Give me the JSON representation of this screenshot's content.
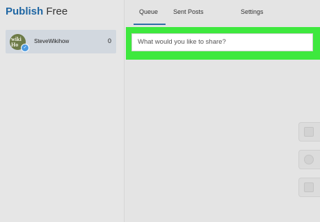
{
  "brand": {
    "strong": "Publish",
    "light": "Free"
  },
  "accounts": [
    {
      "avatar_text": "wiki\nHo",
      "name": "SteveWikihow",
      "count": "0",
      "badge_icon": "twitter-icon"
    }
  ],
  "tabs": [
    {
      "label": "Queue",
      "active": true
    },
    {
      "label": "Sent Posts",
      "active": false
    },
    {
      "label": "Settings",
      "active": false
    }
  ],
  "composer": {
    "placeholder": "What would you like to share?"
  },
  "colors": {
    "brand": "#1f66a3",
    "highlight": "#3ee83e",
    "active_tab": "#2f6ea5",
    "twitter": "#4d9be0"
  },
  "side_buttons": [
    "square-icon",
    "circle-icon",
    "square-icon"
  ]
}
